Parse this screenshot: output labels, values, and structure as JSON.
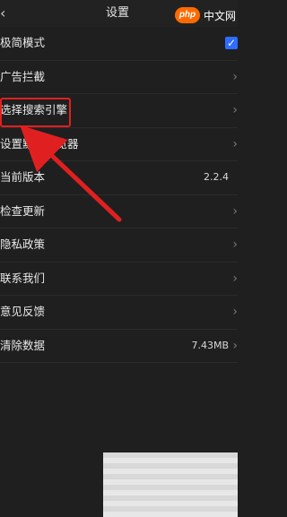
{
  "header": {
    "back_icon": "chevron-left-icon",
    "title": "设置"
  },
  "watermark": {
    "badge": "php",
    "text": "中文网"
  },
  "settings": {
    "items": [
      {
        "label": "极简模式",
        "value": "",
        "control": "checkbox",
        "checked": true,
        "accent": "#2f6cff"
      },
      {
        "label": "广告拦截",
        "value": "",
        "control": "chevron"
      },
      {
        "label": "选择搜索引擎",
        "value": "",
        "control": "chevron"
      },
      {
        "label": "设置默认浏览器",
        "value": "",
        "control": "chevron"
      },
      {
        "label": "当前版本",
        "value": "2.2.4",
        "control": "none"
      },
      {
        "label": "检查更新",
        "value": "",
        "control": "chevron"
      },
      {
        "label": "隐私政策",
        "value": "",
        "control": "chevron"
      },
      {
        "label": "联系我们",
        "value": "",
        "control": "chevron"
      },
      {
        "label": "意见反馈",
        "value": "",
        "control": "chevron"
      },
      {
        "label": "清除数据",
        "value": "7.43MB",
        "control": "chevron"
      }
    ]
  },
  "annotations": {
    "highlight_color": "#e02020",
    "arrow_color": "#e02020"
  }
}
